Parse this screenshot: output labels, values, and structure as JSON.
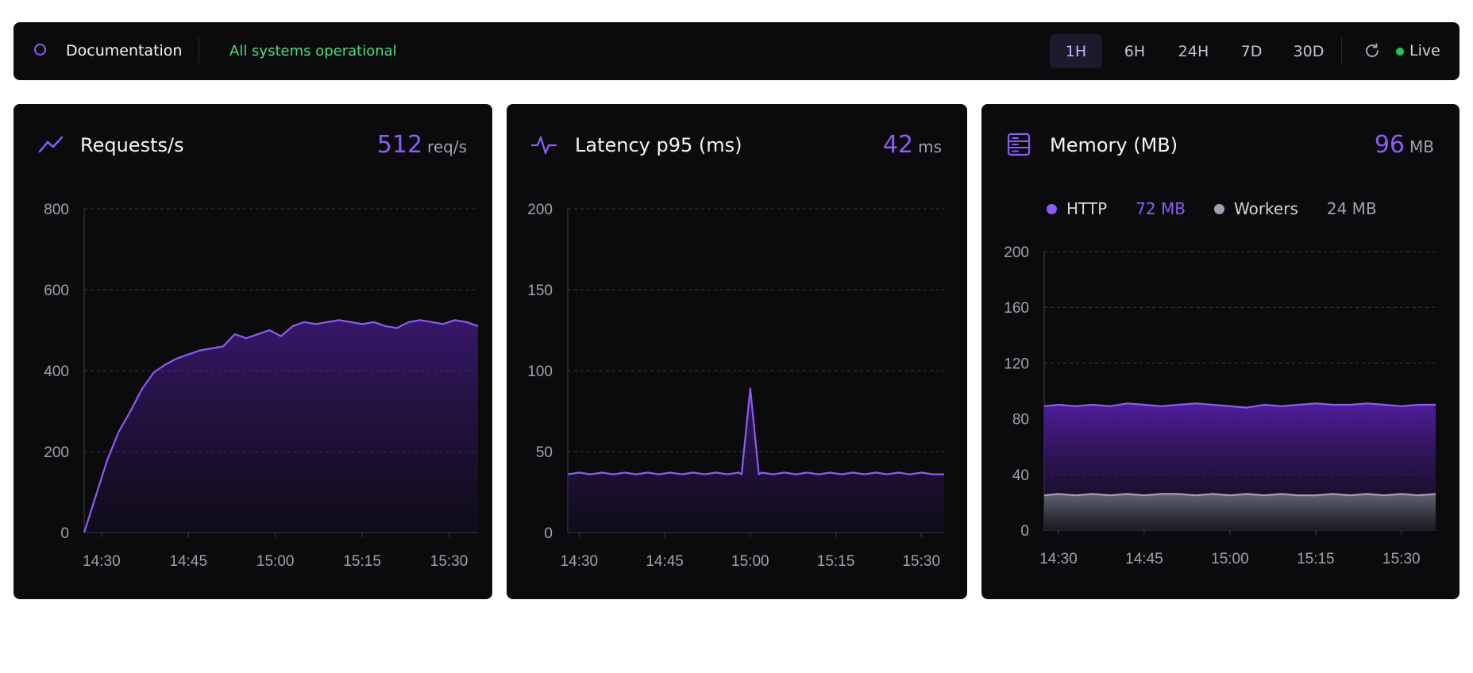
{
  "topbar": {
    "brand": "Documentation",
    "status": "All systems operational",
    "ranges": [
      "1H",
      "6H",
      "24H",
      "7D",
      "30D"
    ],
    "active_range": "1H",
    "live_label": "Live"
  },
  "cards": [
    {
      "title": "Requests/s",
      "icon": "trend-line-icon",
      "value": "512",
      "unit": "req/s",
      "accent": "#8b5cf6"
    },
    {
      "title": "Latency p95 (ms)",
      "icon": "pulse-icon",
      "value": "42",
      "unit": "ms",
      "accent": "#8b5cf6"
    },
    {
      "title": "Memory (MB)",
      "icon": "server-icon",
      "value": "96",
      "unit": "MB",
      "accent": "#8b5cf6",
      "legend": [
        {
          "name": "HTTP",
          "value": "72 MB",
          "color": "#8b5cf6"
        },
        {
          "name": "Workers",
          "value": "24 MB",
          "color": "#9ca3af"
        }
      ]
    }
  ],
  "chart_data": [
    {
      "type": "area",
      "title": "Requests/s",
      "x_ticks": [
        "14:30",
        "14:45",
        "15:00",
        "15:15",
        "15:30"
      ],
      "y_ticks": [
        0,
        200,
        400,
        600,
        800
      ],
      "ylim": [
        0,
        800
      ],
      "x_range_min": [
        -3,
        65
      ],
      "series": [
        {
          "color": "#8b5cf6",
          "x": [
            -3,
            -1,
            1,
            3,
            5,
            7,
            9,
            11,
            13,
            15,
            17,
            19,
            21,
            23,
            25,
            27,
            29,
            31,
            33,
            35,
            37,
            39,
            41,
            43,
            45,
            47,
            49,
            51,
            53,
            55,
            57,
            59,
            61,
            63,
            65
          ],
          "values": [
            0,
            90,
            180,
            250,
            300,
            355,
            395,
            415,
            430,
            440,
            450,
            455,
            460,
            490,
            480,
            490,
            500,
            485,
            510,
            520,
            515,
            520,
            525,
            520,
            515,
            520,
            510,
            505,
            520,
            525,
            520,
            515,
            525,
            520,
            510
          ]
        }
      ]
    },
    {
      "type": "area",
      "title": "Latency p95 (ms)",
      "x_ticks": [
        "14:30",
        "14:45",
        "15:00",
        "15:15",
        "15:30"
      ],
      "y_ticks": [
        0,
        50,
        100,
        150,
        200
      ],
      "ylim": [
        0,
        200
      ],
      "x_range_min": [
        -2,
        64
      ],
      "series": [
        {
          "color": "#8b5cf6",
          "x": [
            -2,
            0,
            2,
            4,
            6,
            8,
            10,
            12,
            14,
            16,
            18,
            20,
            22,
            24,
            26,
            28,
            28.5,
            30,
            31.5,
            32,
            34,
            36,
            38,
            40,
            42,
            44,
            46,
            48,
            50,
            52,
            54,
            56,
            58,
            60,
            62,
            64
          ],
          "values": [
            36,
            37,
            36,
            37,
            36,
            37,
            36,
            37,
            36,
            37,
            36,
            37,
            36,
            37,
            36,
            37,
            36,
            89,
            36,
            37,
            36,
            37,
            36,
            37,
            36,
            37,
            36,
            37,
            36,
            37,
            36,
            37,
            36,
            37,
            36,
            36
          ]
        }
      ]
    },
    {
      "type": "area",
      "title": "Memory (MB)",
      "x_ticks": [
        "14:30",
        "14:45",
        "15:00",
        "15:15",
        "15:30"
      ],
      "y_ticks": [
        0,
        40,
        80,
        120,
        160,
        200
      ],
      "ylim": [
        0,
        200
      ],
      "x_range_min": [
        -2.5,
        66
      ],
      "series": [
        {
          "name": "HTTP",
          "color": "#8b5cf6",
          "x": [
            -2.5,
            0,
            3,
            6,
            9,
            12,
            15,
            18,
            21,
            24,
            27,
            30,
            33,
            36,
            39,
            42,
            45,
            48,
            51,
            54,
            57,
            60,
            63,
            66
          ],
          "values": [
            89,
            90,
            89,
            90,
            89,
            91,
            90,
            89,
            90,
            91,
            90,
            89,
            88,
            90,
            89,
            90,
            91,
            90,
            90,
            91,
            90,
            89,
            90,
            90
          ]
        },
        {
          "name": "Workers",
          "color": "#9ca3af",
          "x": [
            -2.5,
            0,
            3,
            6,
            9,
            12,
            15,
            18,
            21,
            24,
            27,
            30,
            33,
            36,
            39,
            42,
            45,
            48,
            51,
            54,
            57,
            60,
            63,
            66
          ],
          "values": [
            25,
            26,
            25,
            26,
            25,
            26,
            25,
            26,
            26,
            25,
            26,
            25,
            26,
            25,
            26,
            25,
            25,
            26,
            25,
            26,
            25,
            26,
            25,
            26
          ]
        }
      ]
    }
  ]
}
